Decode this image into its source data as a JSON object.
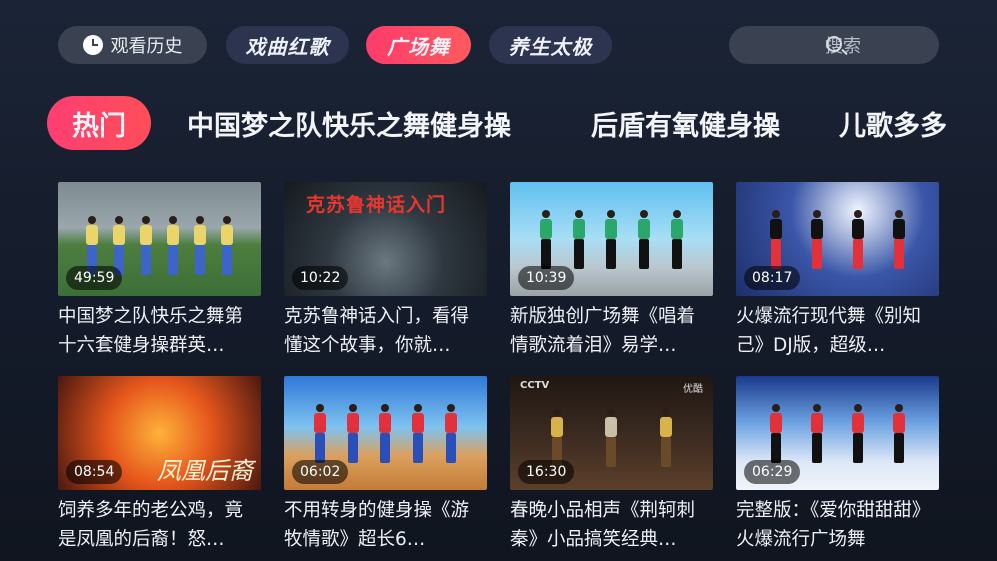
{
  "header": {
    "history_label": "观看历史",
    "categories": [
      "戏曲红歌",
      "广场舞",
      "养生太极"
    ],
    "active_category_index": 1,
    "search_placeholder": "搜索"
  },
  "tabs": [
    {
      "label": "热门",
      "active": true
    },
    {
      "label": "中国梦之队快乐之舞健身操",
      "active": false
    },
    {
      "label": "后盾有氧健身操",
      "active": false
    },
    {
      "label": "儿歌多多",
      "active": false
    }
  ],
  "videos": [
    {
      "duration": "49:59",
      "title": "中国梦之队快乐之舞第十六套健身操群英…"
    },
    {
      "duration": "10:22",
      "title": "克苏鲁神话入门，看得懂这个故事，你就…",
      "thumb_text": "克苏鲁神话入门"
    },
    {
      "duration": "10:39",
      "title": "新版独创广场舞《唱着情歌流着泪》易学…"
    },
    {
      "duration": "08:17",
      "title": "火爆流行现代舞《别知己》DJ版，超级…"
    },
    {
      "duration": "08:54",
      "title": "饲养多年的老公鸡，竟是凤凰的后裔！怒…",
      "thumb_text": "凤凰后裔"
    },
    {
      "duration": "06:02",
      "title": "不用转身的健身操《游牧情歌》超长6…"
    },
    {
      "duration": "16:30",
      "title": "春晚小品相声《荆轲刺秦》小品搞笑经典…",
      "thumb_text": "CCTV",
      "thumb_text_2": "优酷"
    },
    {
      "duration": "06:29",
      "title": "完整版：《爱你甜甜甜》火爆流行广场舞"
    }
  ],
  "colors": {
    "accent_start": "#ff3e72",
    "accent_end": "#ff4e59",
    "pill_bg": "#3a4150",
    "category_bg": "#2c3450",
    "background_top": "#1b2436"
  },
  "icons": {
    "history": "clock-icon",
    "search": "search-icon"
  }
}
